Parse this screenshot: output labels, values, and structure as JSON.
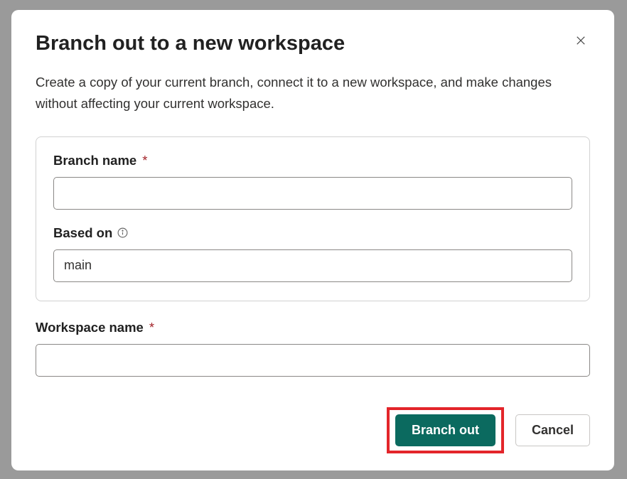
{
  "dialog": {
    "title": "Branch out to a new workspace",
    "description": "Create a copy of your current branch, connect it to a new workspace, and make changes without affecting your current workspace."
  },
  "form": {
    "branch_name": {
      "label": "Branch name",
      "value": ""
    },
    "based_on": {
      "label": "Based on",
      "value": "main"
    },
    "workspace_name": {
      "label": "Workspace name",
      "value": ""
    }
  },
  "buttons": {
    "branch_out": "Branch out",
    "cancel": "Cancel"
  },
  "required_marker": "*"
}
